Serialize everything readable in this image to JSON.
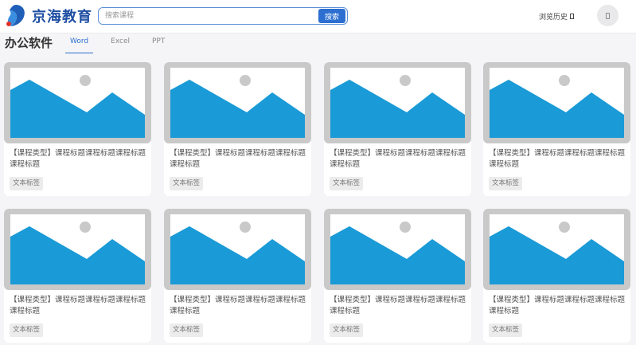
{
  "header": {
    "logo_text": "京海教育",
    "search": {
      "placeholder": "搜索课程",
      "button_label": "搜索"
    },
    "history_label": "浏览历史"
  },
  "category": {
    "title": "办公软件",
    "tabs": [
      {
        "label": "Word",
        "active": true
      },
      {
        "label": "Excel",
        "active": false
      },
      {
        "label": "PPT",
        "active": false
      }
    ]
  },
  "colors": {
    "accent": "#2c6fd1",
    "logo": "#1f4fa3",
    "placeholder_mountain": "#1a9ad6",
    "placeholder_frame": "#c9c9c9"
  },
  "courses": [
    {
      "title": "【课程类型】课程标题课程标题课程标题课程标题",
      "tag": "文本标签"
    },
    {
      "title": "【课程类型】课程标题课程标题课程标题课程标题",
      "tag": "文本标签"
    },
    {
      "title": "【课程类型】课程标题课程标题课程标题课程标题",
      "tag": "文本标签"
    },
    {
      "title": "【课程类型】课程标题课程标题课程标题课程标题",
      "tag": "文本标签"
    },
    {
      "title": "【课程类型】课程标题课程标题课程标题课程标题",
      "tag": "文本标签"
    },
    {
      "title": "【课程类型】课程标题课程标题课程标题课程标题",
      "tag": "文本标签"
    },
    {
      "title": "【课程类型】课程标题课程标题课程标题课程标题",
      "tag": "文本标签"
    },
    {
      "title": "【课程类型】课程标题课程标题课程标题课程标题",
      "tag": "文本标签"
    }
  ]
}
